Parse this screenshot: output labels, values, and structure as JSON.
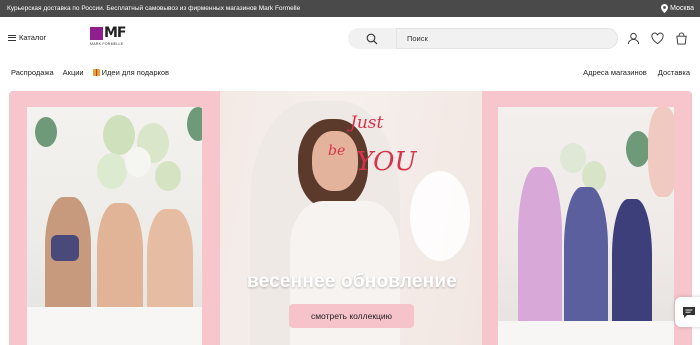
{
  "topbar": {
    "promo": "Курьерская доставка по России. Бесплатный самовывоз из фирменных магазинов Mark Formelle",
    "city": "Москва"
  },
  "header": {
    "catalog": "Каталог",
    "logo_mark": "MF",
    "logo_sub": "MARK FORMELLE",
    "search_placeholder": "Поиск",
    "icons": [
      "user-icon",
      "heart-icon",
      "bag-icon"
    ]
  },
  "nav": {
    "left": [
      "Распродажа",
      "Акции",
      "Идеи для подарков"
    ],
    "right": [
      "Адреса магазинов",
      "Доставка"
    ]
  },
  "banner": {
    "mirror_text_1": "Just",
    "mirror_text_2": "be",
    "mirror_text_3": "YOU",
    "headline": "весеннее обновление",
    "cta": "смотреть коллекцию"
  },
  "colors": {
    "topbar": "#4a4a4a",
    "brand": "#8e1f8c",
    "banner_pink": "#f6c6cc",
    "cta_bg": "#f7c3cb"
  }
}
